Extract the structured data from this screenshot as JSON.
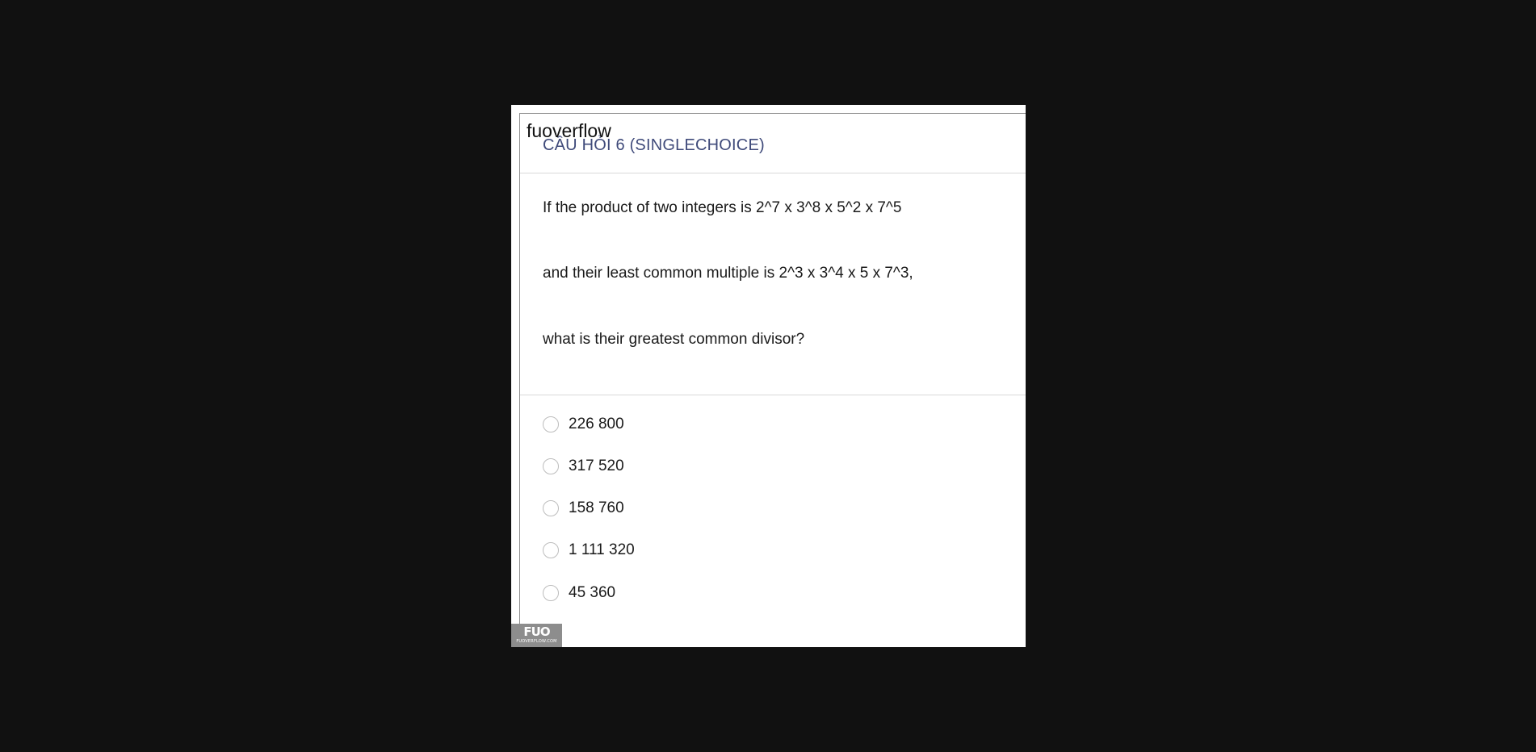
{
  "overlay": {
    "site_label": "fuoverflow"
  },
  "question": {
    "title": "CÂU HỎI 6 (SINGLECHOICE)",
    "lines": [
      "If the product of two integers is 2^7 x 3^8 x 5^2 x 7^5",
      "and their least common multiple is 2^3 x 3^4 x 5 x 7^3,",
      "what is their greatest common divisor?"
    ]
  },
  "options": [
    {
      "label": "226 800",
      "selected": false
    },
    {
      "label": "317 520",
      "selected": false
    },
    {
      "label": "158 760",
      "selected": false
    },
    {
      "label": "1 111 320",
      "selected": false
    },
    {
      "label": "45 360",
      "selected": false
    }
  ],
  "watermark": {
    "logo_text": "FUO",
    "domain": "FUOVERFLOW.COM"
  },
  "colors": {
    "background": "#111111",
    "title": "#3f4a7a",
    "text": "#1a1a1a",
    "radio_border": "#bdbdbd",
    "watermark_bg": "#8d8d8d"
  }
}
